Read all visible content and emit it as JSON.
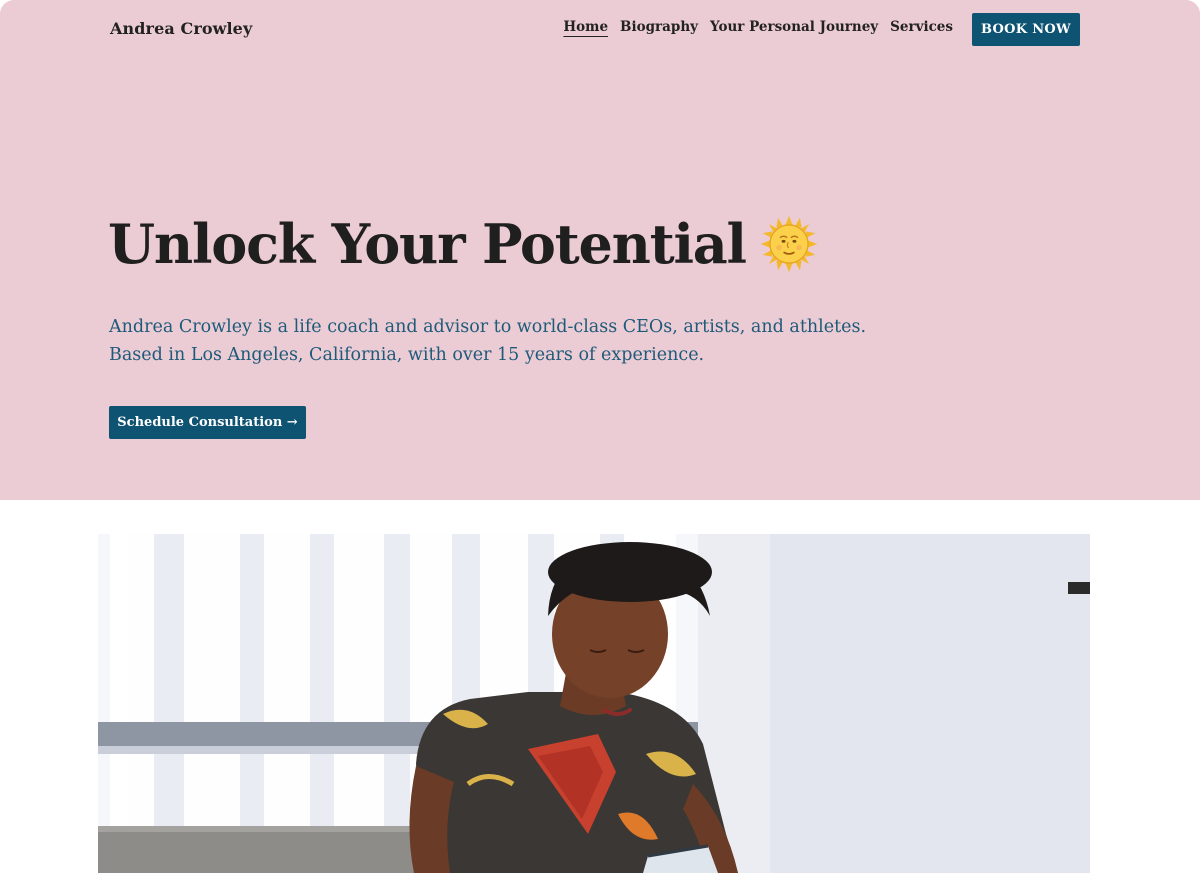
{
  "brand": {
    "name": "Andrea Crowley"
  },
  "nav": {
    "items": [
      {
        "label": "Home",
        "active": true
      },
      {
        "label": "Biography",
        "active": false
      },
      {
        "label": "Your Personal Journey",
        "active": false
      },
      {
        "label": "Services",
        "active": false
      }
    ],
    "book_label": "BOOK NOW"
  },
  "hero": {
    "headline": "Unlock Your Potential",
    "headline_icon": "sun-with-face-icon",
    "subtitle_line1": "Andrea Crowley is a life coach and advisor to world-class CEOs, artists, and athletes.",
    "subtitle_line2": "Based in Los Angeles, California, with over 15 years of experience.",
    "cta_label": "Schedule Consultation →"
  },
  "colors": {
    "hero_background": "#ebcbd4",
    "accent": "#0e5371",
    "subtitle_text": "#1e5a79",
    "heading_text": "#1f1f1f"
  },
  "photo": {
    "alt": "woman-reading-photo"
  }
}
